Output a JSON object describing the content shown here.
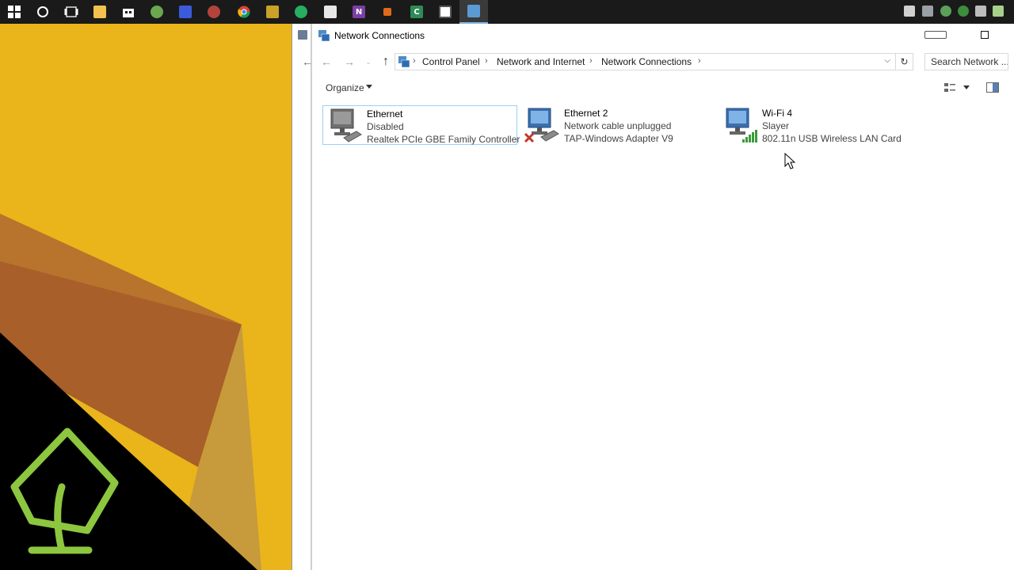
{
  "taskbar": {
    "icons": [
      "windows-logo-icon",
      "cortana-icon",
      "task-view-icon",
      "file-explorer-icon",
      "store-icon",
      "app-icon",
      "daemon-tools-icon",
      "app-icon",
      "chrome-icon",
      "app-icon",
      "app-icon",
      "calculator-icon",
      "onenote-icon",
      "app-icon",
      "camtasia-icon",
      "app-icon",
      "network-connections-icon"
    ],
    "onenote_letter": "N",
    "camtasia_letter": "C"
  },
  "window": {
    "title": "Network Connections"
  },
  "address": {
    "crumbs": [
      "Control Panel",
      "Network and Internet",
      "Network Connections"
    ],
    "search_placeholder": "Search Network ..."
  },
  "toolbar": {
    "organize_label": "Organize"
  },
  "connections": [
    {
      "name": "Ethernet",
      "status": "Disabled",
      "adapter": "Realtek PCIe GBE Family Controller",
      "icon": "ethernet-disabled-icon"
    },
    {
      "name": "Ethernet 2",
      "status": "Network cable unplugged",
      "adapter": "TAP-Windows Adapter V9",
      "icon": "ethernet-unplugged-icon"
    },
    {
      "name": "Wi-Fi 4",
      "status": "Slayer",
      "adapter": "802.11n USB Wireless LAN Card",
      "icon": "wifi-adapter-icon"
    }
  ],
  "colors": {
    "desktop_yellow": "#e8b51a",
    "taskbar": "#1a1a1a",
    "accent_green": "#8dc63f",
    "selection_border": "#9ad0f5"
  }
}
